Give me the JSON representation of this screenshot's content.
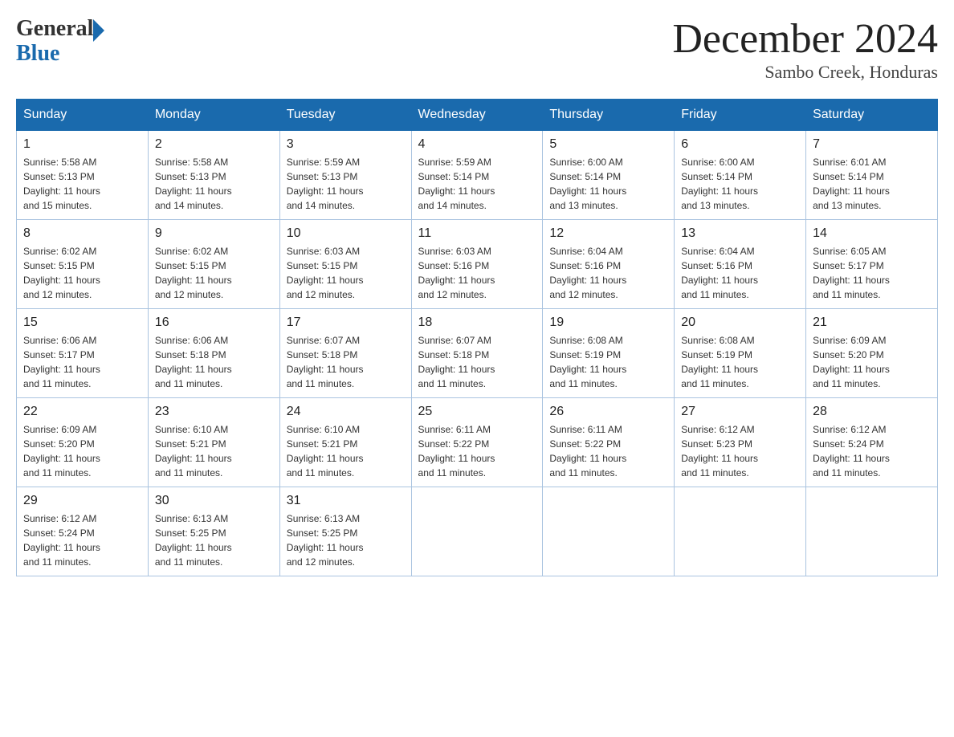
{
  "header": {
    "logo_general": "General",
    "logo_blue": "Blue",
    "month_title": "December 2024",
    "location": "Sambo Creek, Honduras"
  },
  "days_of_week": [
    "Sunday",
    "Monday",
    "Tuesday",
    "Wednesday",
    "Thursday",
    "Friday",
    "Saturday"
  ],
  "weeks": [
    [
      {
        "day": "1",
        "sunrise": "5:58 AM",
        "sunset": "5:13 PM",
        "daylight": "11 hours and 15 minutes."
      },
      {
        "day": "2",
        "sunrise": "5:58 AM",
        "sunset": "5:13 PM",
        "daylight": "11 hours and 14 minutes."
      },
      {
        "day": "3",
        "sunrise": "5:59 AM",
        "sunset": "5:13 PM",
        "daylight": "11 hours and 14 minutes."
      },
      {
        "day": "4",
        "sunrise": "5:59 AM",
        "sunset": "5:14 PM",
        "daylight": "11 hours and 14 minutes."
      },
      {
        "day": "5",
        "sunrise": "6:00 AM",
        "sunset": "5:14 PM",
        "daylight": "11 hours and 13 minutes."
      },
      {
        "day": "6",
        "sunrise": "6:00 AM",
        "sunset": "5:14 PM",
        "daylight": "11 hours and 13 minutes."
      },
      {
        "day": "7",
        "sunrise": "6:01 AM",
        "sunset": "5:14 PM",
        "daylight": "11 hours and 13 minutes."
      }
    ],
    [
      {
        "day": "8",
        "sunrise": "6:02 AM",
        "sunset": "5:15 PM",
        "daylight": "11 hours and 12 minutes."
      },
      {
        "day": "9",
        "sunrise": "6:02 AM",
        "sunset": "5:15 PM",
        "daylight": "11 hours and 12 minutes."
      },
      {
        "day": "10",
        "sunrise": "6:03 AM",
        "sunset": "5:15 PM",
        "daylight": "11 hours and 12 minutes."
      },
      {
        "day": "11",
        "sunrise": "6:03 AM",
        "sunset": "5:16 PM",
        "daylight": "11 hours and 12 minutes."
      },
      {
        "day": "12",
        "sunrise": "6:04 AM",
        "sunset": "5:16 PM",
        "daylight": "11 hours and 12 minutes."
      },
      {
        "day": "13",
        "sunrise": "6:04 AM",
        "sunset": "5:16 PM",
        "daylight": "11 hours and 11 minutes."
      },
      {
        "day": "14",
        "sunrise": "6:05 AM",
        "sunset": "5:17 PM",
        "daylight": "11 hours and 11 minutes."
      }
    ],
    [
      {
        "day": "15",
        "sunrise": "6:06 AM",
        "sunset": "5:17 PM",
        "daylight": "11 hours and 11 minutes."
      },
      {
        "day": "16",
        "sunrise": "6:06 AM",
        "sunset": "5:18 PM",
        "daylight": "11 hours and 11 minutes."
      },
      {
        "day": "17",
        "sunrise": "6:07 AM",
        "sunset": "5:18 PM",
        "daylight": "11 hours and 11 minutes."
      },
      {
        "day": "18",
        "sunrise": "6:07 AM",
        "sunset": "5:18 PM",
        "daylight": "11 hours and 11 minutes."
      },
      {
        "day": "19",
        "sunrise": "6:08 AM",
        "sunset": "5:19 PM",
        "daylight": "11 hours and 11 minutes."
      },
      {
        "day": "20",
        "sunrise": "6:08 AM",
        "sunset": "5:19 PM",
        "daylight": "11 hours and 11 minutes."
      },
      {
        "day": "21",
        "sunrise": "6:09 AM",
        "sunset": "5:20 PM",
        "daylight": "11 hours and 11 minutes."
      }
    ],
    [
      {
        "day": "22",
        "sunrise": "6:09 AM",
        "sunset": "5:20 PM",
        "daylight": "11 hours and 11 minutes."
      },
      {
        "day": "23",
        "sunrise": "6:10 AM",
        "sunset": "5:21 PM",
        "daylight": "11 hours and 11 minutes."
      },
      {
        "day": "24",
        "sunrise": "6:10 AM",
        "sunset": "5:21 PM",
        "daylight": "11 hours and 11 minutes."
      },
      {
        "day": "25",
        "sunrise": "6:11 AM",
        "sunset": "5:22 PM",
        "daylight": "11 hours and 11 minutes."
      },
      {
        "day": "26",
        "sunrise": "6:11 AM",
        "sunset": "5:22 PM",
        "daylight": "11 hours and 11 minutes."
      },
      {
        "day": "27",
        "sunrise": "6:12 AM",
        "sunset": "5:23 PM",
        "daylight": "11 hours and 11 minutes."
      },
      {
        "day": "28",
        "sunrise": "6:12 AM",
        "sunset": "5:24 PM",
        "daylight": "11 hours and 11 minutes."
      }
    ],
    [
      {
        "day": "29",
        "sunrise": "6:12 AM",
        "sunset": "5:24 PM",
        "daylight": "11 hours and 11 minutes."
      },
      {
        "day": "30",
        "sunrise": "6:13 AM",
        "sunset": "5:25 PM",
        "daylight": "11 hours and 11 minutes."
      },
      {
        "day": "31",
        "sunrise": "6:13 AM",
        "sunset": "5:25 PM",
        "daylight": "11 hours and 12 minutes."
      },
      null,
      null,
      null,
      null
    ]
  ],
  "labels": {
    "sunrise": "Sunrise:",
    "sunset": "Sunset:",
    "daylight": "Daylight:"
  }
}
